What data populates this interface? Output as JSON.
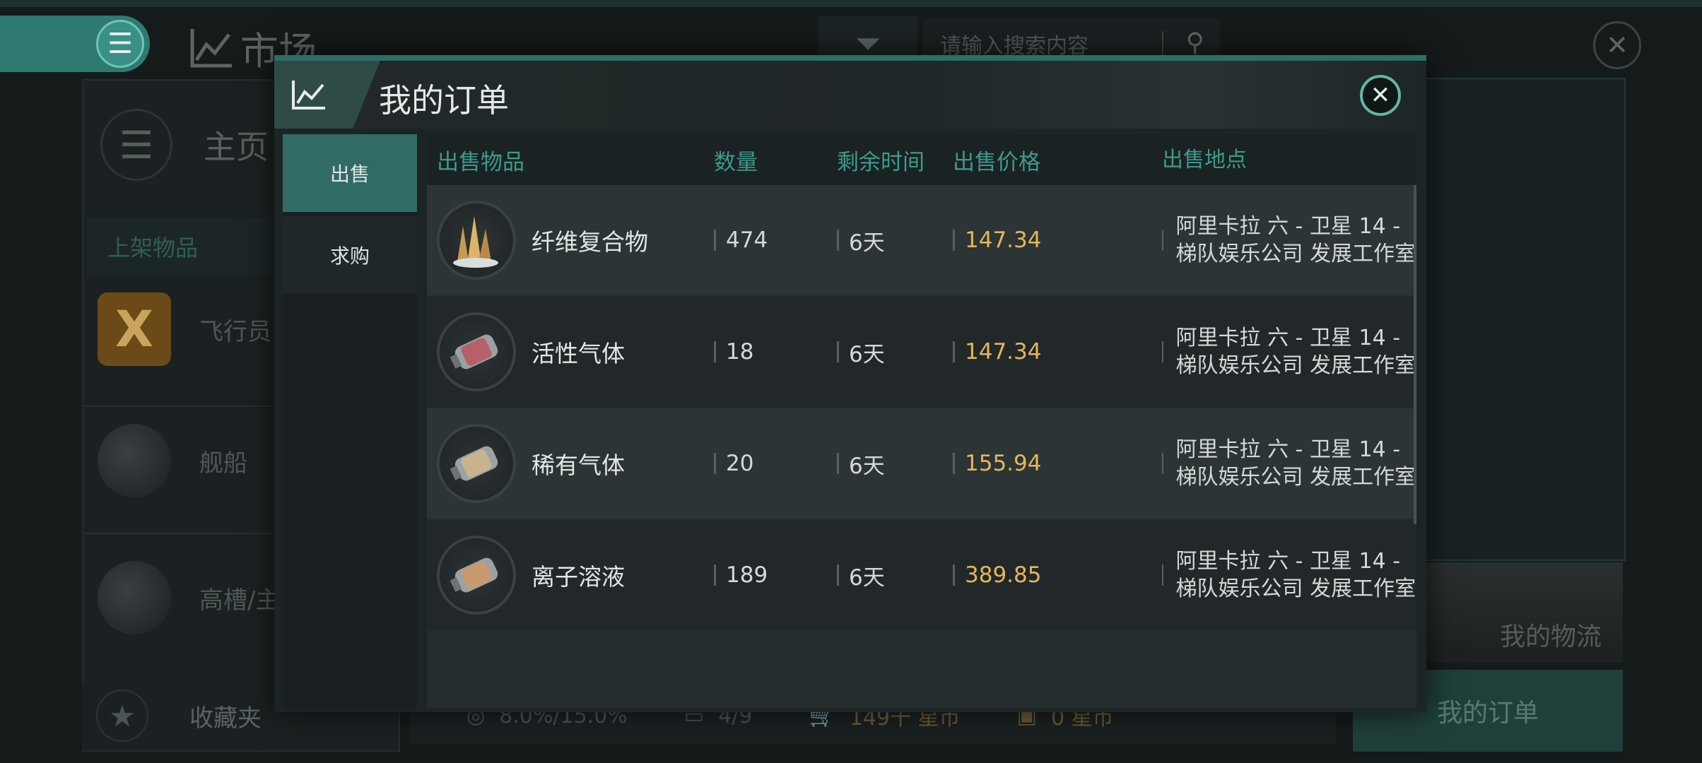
{
  "background": {
    "market_title": "市场",
    "search_placeholder": "请输入搜索内容",
    "home_label": "主页",
    "listing_tab": "上架物品",
    "categories": [
      "飞行员",
      "舰船",
      "高槽/主"
    ],
    "favorites_label": "收藏夹",
    "status": {
      "tax": "8.0%/15.0%",
      "orders": "4/9",
      "escrow": "149千 星币",
      "balance": "0 星币"
    },
    "logistics_label": "我的物流",
    "my_orders_label": "我的订单"
  },
  "modal": {
    "title": "我的订单",
    "tabs": [
      {
        "label": "出售",
        "active": true
      },
      {
        "label": "求购",
        "active": false
      }
    ],
    "columns": {
      "item": "出售物品",
      "quantity": "数量",
      "remaining": "剩余时间",
      "price": "出售价格",
      "location": "出售地点"
    },
    "rows": [
      {
        "name": "纤维复合物",
        "icon": "crystal-icon",
        "quantity": "474",
        "remaining": "6天",
        "price": "147.34",
        "location": "阿里卡拉 六 - 卫星 14 - 梯队娱乐公司 发展工作室"
      },
      {
        "name": "活性气体",
        "icon": "gas-canister-icon",
        "quantity": "18",
        "remaining": "6天",
        "price": "147.34",
        "location": "阿里卡拉 六 - 卫星 14 - 梯队娱乐公司 发展工作室"
      },
      {
        "name": "稀有气体",
        "icon": "gas-canister-icon",
        "quantity": "20",
        "remaining": "6天",
        "price": "155.94",
        "location": "阿里卡拉 六 - 卫星 14 - 梯队娱乐公司 发展工作室"
      },
      {
        "name": "离子溶液",
        "icon": "gas-canister-icon",
        "quantity": "189",
        "remaining": "6天",
        "price": "389.85",
        "location": "阿里卡拉 六 - 卫星 14 - 梯队娱乐公司 发展工作室"
      }
    ]
  },
  "colors": {
    "accent": "#316b65",
    "header_text": "#3d9a8c",
    "price": "#e3b65a"
  }
}
